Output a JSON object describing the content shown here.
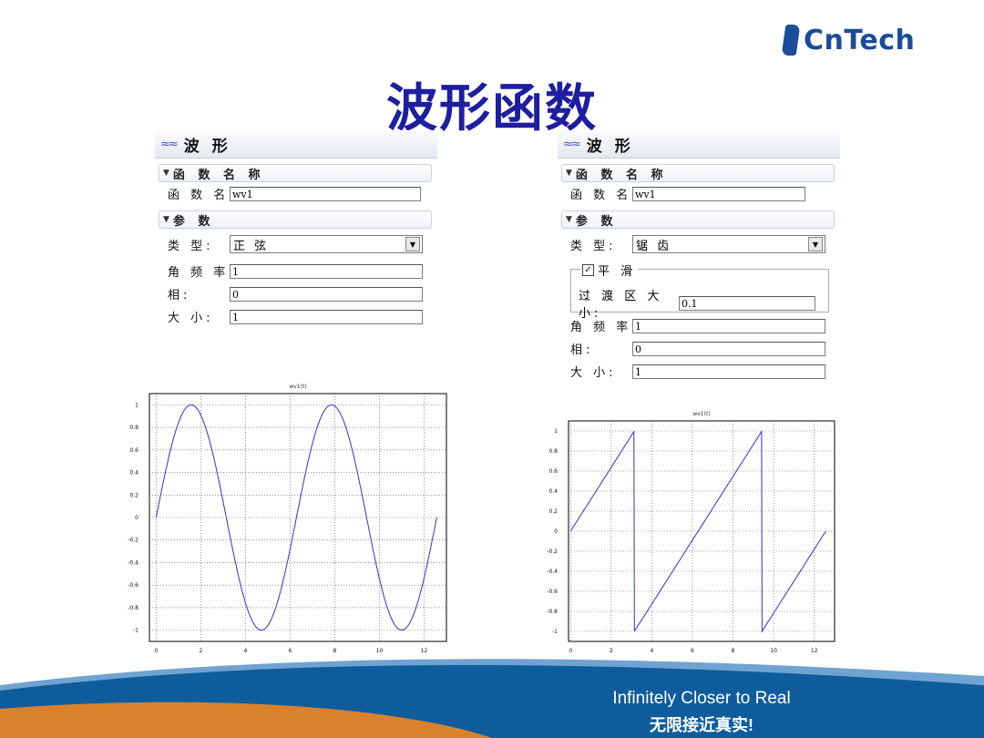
{
  "logo": {
    "prefix": "Cn",
    "suffix": "Tech"
  },
  "slide_title": "波形函数",
  "panels": [
    {
      "header": "波 形",
      "sec_name": "函 数 名 称",
      "name_label": "函 数 名 称:",
      "name_value": "wv1",
      "sec_params": "参 数",
      "type_label": "类 型:",
      "type_value": "正 弦",
      "freq_label": "角 频 率:",
      "freq_value": "1",
      "phase_label": "相:",
      "phase_value": "0",
      "amp_label": "大 小:",
      "amp_value": "1"
    },
    {
      "header": "波 形",
      "sec_name": "函 数 名 称",
      "name_label": "函 数 名 称:",
      "name_value": "wv1",
      "sec_params": "参 数",
      "type_label": "类 型:",
      "type_value": "锯 齿",
      "smooth_label": "平 滑",
      "smooth_checked": true,
      "trans_label": "过 渡 区 大 小:",
      "trans_value": "0.1",
      "freq_label": "角 频 率:",
      "freq_value": "1",
      "phase_label": "相:",
      "phase_value": "0",
      "amp_label": "大 小:",
      "amp_value": "1"
    }
  ],
  "chart_data": [
    {
      "type": "line",
      "title": "wv1(t)",
      "function": "sine",
      "xlim": [
        -0.3,
        13.0
      ],
      "ylim": [
        -1.1,
        1.1
      ],
      "xticks": [
        "0",
        "2",
        "4",
        "6",
        "8",
        "10",
        "12"
      ],
      "yticks": [
        "1",
        "0.8",
        "0.6",
        "0.4",
        "0.2",
        "0",
        "-0.2",
        "-0.4",
        "-0.6",
        "-0.8",
        "-1"
      ],
      "x_range": [
        0,
        12.57
      ],
      "grid": true,
      "line_color": "#3030d0"
    },
    {
      "type": "line",
      "title": "wv1(t)",
      "function": "sawtooth",
      "xlim": [
        -0.1,
        13.0
      ],
      "ylim": [
        -1.1,
        1.1
      ],
      "xticks": [
        "0",
        "2",
        "4",
        "6",
        "8",
        "10",
        "12"
      ],
      "yticks": [
        "1",
        "0.8",
        "0.6",
        "0.4",
        "0.2",
        "0",
        "-0.2",
        "-0.4",
        "-0.6",
        "-0.8",
        "-1"
      ],
      "x_range": [
        0,
        12.57
      ],
      "grid": true,
      "line_color": "#3030d0"
    }
  ],
  "footer": {
    "english": "Infinitely Closer to Real",
    "chinese": "无限接近真实!"
  },
  "colors": {
    "title": "#1e1ea0",
    "brand": "#1a4c9a",
    "footer_blue": "#0f5c9c",
    "footer_orange": "#d9822b"
  }
}
